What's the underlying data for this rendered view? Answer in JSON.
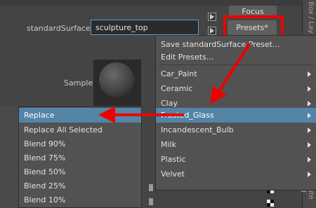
{
  "attribute_editor": {
    "shader_label": "standardSurface:",
    "shader_name": "sculpture_top",
    "focus_label": "Focus",
    "presets_label": "Presets*",
    "sample_label": "Sample",
    "side_tab_top": "Box / Lay",
    "side_tab_bottom": "bute Ed"
  },
  "presets_menu": {
    "actions": [
      {
        "label": "Save standardSurface Preset..."
      },
      {
        "label": "Edit Presets..."
      }
    ],
    "presets": [
      {
        "label": "Car_Paint"
      },
      {
        "label": "Ceramic"
      },
      {
        "label": "Clay"
      },
      {
        "label": "Frosted_Glass"
      },
      {
        "label": "Incandescent_Bulb"
      },
      {
        "label": "Milk"
      },
      {
        "label": "Plastic"
      },
      {
        "label": "Velvet"
      }
    ],
    "highlighted": "Frosted_Glass"
  },
  "preset_submenu": {
    "items": [
      {
        "label": "Replace"
      },
      {
        "label": "Replace All Selected"
      },
      {
        "label": "Blend 90%"
      },
      {
        "label": "Blend 75%"
      },
      {
        "label": "Blend 50%"
      },
      {
        "label": "Blend 25%"
      },
      {
        "label": "Blend 10%"
      }
    ],
    "highlighted": "Replace"
  },
  "colors": {
    "highlight": "#5285a6",
    "annotation_red": "#ee0000",
    "field_focus_border": "#5aa0d8"
  }
}
